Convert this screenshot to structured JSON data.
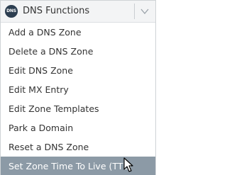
{
  "header": {
    "logo_text": "DNS",
    "title": "DNS Functions"
  },
  "menu": {
    "items": [
      {
        "label": "Add a DNS Zone"
      },
      {
        "label": "Delete a DNS Zone"
      },
      {
        "label": "Edit DNS Zone"
      },
      {
        "label": "Edit MX Entry"
      },
      {
        "label": "Edit Zone Templates"
      },
      {
        "label": "Park a Domain"
      },
      {
        "label": "Reset a DNS Zone"
      },
      {
        "label": "Set Zone Time To Live (TTL)"
      }
    ],
    "active_index": 7
  },
  "colors": {
    "header_bg": "#f3f4f5",
    "active_bg": "#8c9aa6",
    "logo_bg": "#2c3e50",
    "text": "#333333"
  },
  "icons": {
    "logo": "dns-logo-icon",
    "toggle": "chevron-down-icon",
    "cursor": "mouse-pointer-icon"
  }
}
